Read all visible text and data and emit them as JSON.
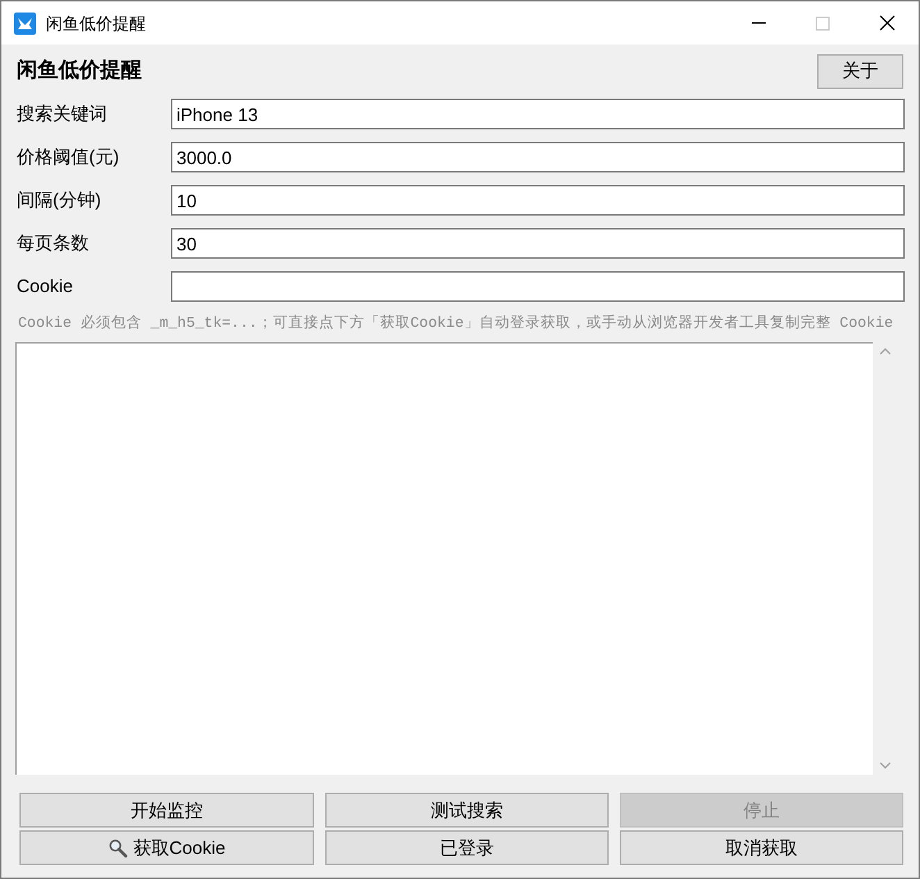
{
  "window": {
    "title": "闲鱼低价提醒",
    "maximize_disabled": true
  },
  "header": {
    "title": "闲鱼低价提醒",
    "about_button": "关于"
  },
  "fields": [
    {
      "label": "搜索关键词",
      "value": "iPhone 13"
    },
    {
      "label": "价格阈值(元)",
      "value": "3000.0"
    },
    {
      "label": "间隔(分钟)",
      "value": "10"
    },
    {
      "label": "每页条数",
      "value": "30"
    },
    {
      "label": "Cookie"
    }
  ],
  "hint": "Cookie 必须包含 _m_h5_tk=...；可直接点下方「获取Cookie」自动登录获取，或手动从浏览器开发者工具复制完整 Cookie",
  "buttons": [
    {
      "label": "开始监控",
      "kind": "plain",
      "disabled": false
    },
    {
      "label": "测试搜索",
      "kind": "plain",
      "disabled": false
    },
    {
      "label": "停止",
      "kind": "plain",
      "disabled": true
    },
    {
      "label": "获取Cookie",
      "kind": "with_icon",
      "disabled": false
    },
    {
      "label": "已登录",
      "kind": "plain",
      "disabled": false
    },
    {
      "label": "取消获取",
      "kind": "plain",
      "disabled": false
    }
  ]
}
